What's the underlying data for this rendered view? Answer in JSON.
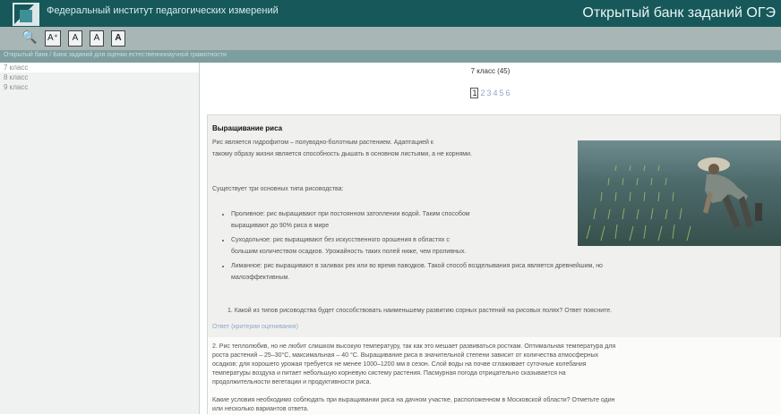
{
  "header": {
    "org": "Федеральный институт педагогических измерений",
    "bank_title": "Открытый банк заданий ОГЭ"
  },
  "toolbar": {
    "search_glyph": "🔍",
    "font_plus_label": "A⁺",
    "font_box_label": "A",
    "font_a_label": "A",
    "font_a2_label": "A"
  },
  "breadcrumb": "Открытый банк / Банк заданий для оценки естественнонаучной грамотности",
  "sidebar": {
    "items": [
      {
        "label": "7 класс"
      },
      {
        "label": "8 класс"
      },
      {
        "label": "9 класс"
      }
    ]
  },
  "main": {
    "grade_title": "7 класс (45)",
    "pages": [
      "1",
      "2",
      "3",
      "4",
      "5",
      "6"
    ],
    "current_page": "1",
    "task_title": "Выращивание риса",
    "intro_line1": "Рис является гидрофитом – полуводно-болотным растением. Адаптацией к",
    "intro_line2": "такому образу жизни является способность дышать в основном листьями, а не корнями.",
    "types_intro": "Существует три основных типа рисоводства:",
    "types": [
      {
        "line1": "Проливное: рис выращивают при постоянном затоплении водой. Таким способом",
        "line2": "выращивают до 90% риса в мире"
      },
      {
        "line1": "Суходольное: рис выращивают без искусственного орошения в областях с",
        "line2": "большим количеством осадков. Урожайность таких полей ниже, чем проливных."
      },
      {
        "line1": "Лиманное: рис выращивают в заливах рек или во время паводков. Такой способ возделывания риса является древнейшим, но",
        "line2": "малоэффективным."
      }
    ],
    "question1": "1. Какой из типов рисоводства будет способствовать наименьшему развитию сорных растений на рисовых полях? Ответ поясните.",
    "answer_link": "Ответ (критерии оценивания)",
    "p2_line1": "2. Рис теплолюбив, но не любит слишком высокую температуру, так как это мешает развиваться росткам. Оптимальная температура для",
    "p2_line2": "роста растений – 25–30°С, максимальная – 40 °С. Выращивание риса в значительной степени зависит от количества атмосферных",
    "p2_line3": "осадков: для хорошего урожая требуется не менее 1000–1200 мм в сезон. Слой воды на почве сглаживает суточные колебания",
    "p2_line4": "температуры воздуха и питает небольшую корневую систему растения. Пасмурная погода отрицательно сказывается на",
    "p2_line5": "продолжительности вегетации и продуктивности риса.",
    "p3_line1": "Какие условия необходимо соблюдать при выращивании риса на дачном участке, расположенном в Московской области? Отметьте один",
    "p3_line2": "или несколько вариантов ответа."
  }
}
